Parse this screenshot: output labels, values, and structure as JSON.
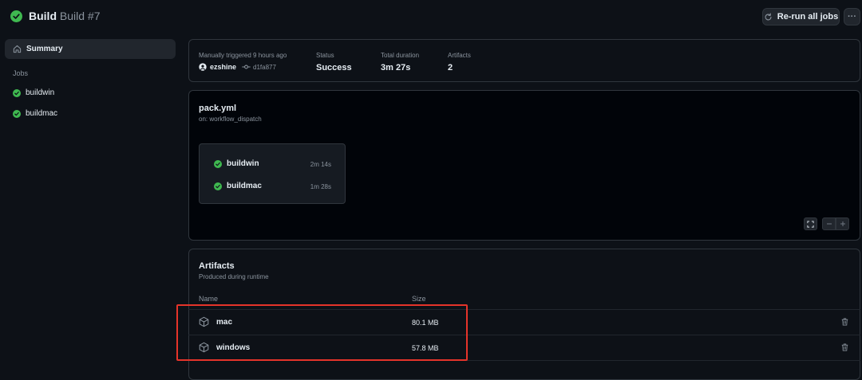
{
  "header": {
    "workflow_name": "Build",
    "run_name": "Build #7",
    "rerun_label": "Re-run all jobs",
    "more_label": "···"
  },
  "sidebar": {
    "summary_label": "Summary",
    "jobs_heading": "Jobs",
    "jobs": [
      {
        "label": "buildwin",
        "status": "success"
      },
      {
        "label": "buildmac",
        "status": "success"
      }
    ]
  },
  "summary": {
    "trigger_label": "Manually triggered 9 hours ago",
    "actor": "ezshine",
    "commit": "d1fa877",
    "status_label": "Status",
    "status_value": "Success",
    "duration_label": "Total duration",
    "duration_value": "3m 27s",
    "artifacts_label": "Artifacts",
    "artifacts_value": "2"
  },
  "workflow": {
    "file": "pack.yml",
    "trigger": "on: workflow_dispatch",
    "jobs": [
      {
        "label": "buildwin",
        "duration": "2m 14s"
      },
      {
        "label": "buildmac",
        "duration": "1m 28s"
      }
    ]
  },
  "artifacts": {
    "title": "Artifacts",
    "subtitle": "Produced during runtime",
    "col_name": "Name",
    "col_size": "Size",
    "items": [
      {
        "name": "mac",
        "size": "80.1 MB"
      },
      {
        "name": "windows",
        "size": "57.8 MB"
      }
    ]
  },
  "colors": {
    "background": "#0d1117",
    "success": "#3fb950",
    "highlight": "#e5342a"
  }
}
